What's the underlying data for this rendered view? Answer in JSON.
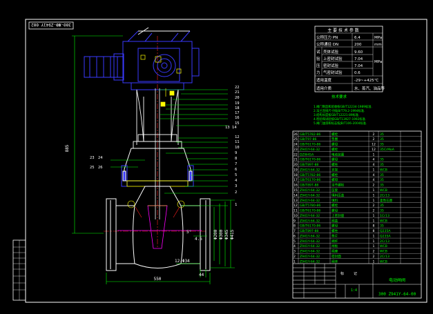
{
  "drawing_no_rotated": "300-ЖФ-Z941Y 002",
  "spec_table": {
    "title": "主 要 技 术 参 数",
    "rows": [
      {
        "label": "公称压力 PN",
        "value": "6.4",
        "unit": "MPa"
      },
      {
        "label": "公称通径 DN",
        "value": "200",
        "unit": "mm"
      },
      {
        "label": "壳体试验",
        "value": "9.60",
        "unit": ""
      },
      {
        "label": "上密封试验",
        "value": "7.04",
        "unit": "MPa"
      },
      {
        "label": "密封试验",
        "value": "7.04",
        "unit": ""
      },
      {
        "label": "气密封试验",
        "value": "0.6",
        "unit": ""
      },
      {
        "label": "适用温度",
        "value": "-29~+425",
        "unit": "℃"
      },
      {
        "label": "适用介质",
        "value": "水、蒸汽、油品等",
        "unit": ""
      }
    ],
    "side_chars": [
      "试",
      "验",
      "压",
      "力"
    ]
  },
  "notes": {
    "title": "技术要求",
    "lines": [
      "1.阀门制造和验收按GB/T12234-1989标准.",
      "2.法兰连接尺寸按JB/T79.2-1994标准.",
      "3.结构长度按GB/T12221-89标准.",
      "4.检验和试验按GB/T13927-1992标准.",
      "5.阀门油漆和标志按JB/T106-2004标准."
    ]
  },
  "dimensions": {
    "height": "885",
    "length": "550",
    "bolt": "12-Φ34",
    "d1": "Φ200",
    "d2": "Φ300",
    "d3": "Φ345",
    "d4": "Φ415",
    "t1": "44",
    "t2": "4.5",
    "angle": "5°"
  },
  "callouts_right": [
    "22",
    "21",
    "20",
    "19",
    "18",
    "17",
    "16",
    "15",
    "14",
    "13",
    "12",
    "11",
    "10",
    "9",
    "8",
    "7",
    "6",
    "5",
    "4",
    "3",
    "2",
    "1"
  ],
  "callouts_left": [
    "23",
    "24",
    "25",
    "26"
  ],
  "callout_pair_a": "13  14",
  "bom_rows": [
    {
      "no": "26",
      "code": "GB/T5782-86",
      "name": "螺栓",
      "qty": "2",
      "mat": "35"
    },
    {
      "no": "25",
      "code": "GB/T97-86",
      "name": "垫圈",
      "qty": "2",
      "mat": "35"
    },
    {
      "no": "24",
      "code": "GB/T6170-86",
      "name": "螺母",
      "qty": "12",
      "mat": "35"
    },
    {
      "no": "23",
      "code": "Z941Y-64-32",
      "name": "螺栓",
      "qty": "12",
      "mat": "35CrMoA"
    },
    {
      "no": "22",
      "code": "DZW45A",
      "name": "电动装置",
      "qty": "1",
      "mat": ""
    },
    {
      "no": "21",
      "code": "GB/T6170-86",
      "name": "螺母",
      "qty": "4",
      "mat": "35"
    },
    {
      "no": "20",
      "code": "GB/T897-88",
      "name": "螺柱",
      "qty": "4",
      "mat": "35"
    },
    {
      "no": "19",
      "code": "Z941Y-64-32",
      "name": "支架",
      "qty": "1",
      "mat": "WCB"
    },
    {
      "no": "18",
      "code": "GB/T5782-86",
      "name": "螺栓",
      "qty": "4",
      "mat": "35"
    },
    {
      "no": "17",
      "code": "GB/T6170-86",
      "name": "螺母",
      "qty": "4",
      "mat": "35"
    },
    {
      "no": "16",
      "code": "GB/T897-88",
      "name": "活节螺栓",
      "qty": "2",
      "mat": "35"
    },
    {
      "no": "15",
      "code": "Z941Y-64-32",
      "name": "压套",
      "qty": "1",
      "mat": "WCB"
    },
    {
      "no": "14",
      "code": "Z941Y-64-32",
      "name": "填料压盖",
      "qty": "1",
      "mat": "2Cr13"
    },
    {
      "no": "13",
      "code": "Z941Y-64-32",
      "name": "填料",
      "qty": "1",
      "mat": "柔性石墨"
    },
    {
      "no": "12",
      "code": "GB/T5780-86",
      "name": "螺栓",
      "qty": "2",
      "mat": "35"
    },
    {
      "no": "11",
      "code": "GB/T6170-86",
      "name": "螺母",
      "qty": "2",
      "mat": "35"
    },
    {
      "no": "10",
      "code": "Z941Y-64-32",
      "name": "上密封座",
      "qty": "1",
      "mat": "1Cr13"
    },
    {
      "no": "9",
      "code": "Z941Y-64-32",
      "name": "阀盖",
      "qty": "1",
      "mat": "WCB"
    },
    {
      "no": "8",
      "code": "GB/T6170-86",
      "name": "螺母",
      "qty": "8",
      "mat": "35"
    },
    {
      "no": "7",
      "code": "GB/T897-88",
      "name": "螺柱",
      "qty": "8",
      "mat": "Q235A"
    },
    {
      "no": "6",
      "code": "Z941Y-64-32",
      "name": "垫片",
      "qty": "1",
      "mat": "Q235A"
    },
    {
      "no": "5",
      "code": "Z941Y-64-32",
      "name": "阀杆",
      "qty": "1",
      "mat": "2Cr13"
    },
    {
      "no": "4",
      "code": "Z941Y-64-32",
      "name": "闸板",
      "qty": "1",
      "mat": "WCB"
    },
    {
      "no": "3",
      "code": "Z941Y-64-32",
      "name": "阀座",
      "qty": "2",
      "mat": "WCB"
    },
    {
      "no": "2",
      "code": "Z941Y-64-32",
      "name": "密封面",
      "qty": "2",
      "mat": "2Cr13"
    },
    {
      "no": "1",
      "code": "Z941Y-64-32",
      "name": "阀体",
      "qty": "1",
      "mat": "WCB"
    }
  ],
  "title_block": {
    "title": "电动闸阀",
    "drawing_no": "300 Z941Y-64-00",
    "scale_label": "1:4",
    "chars": [
      "标",
      "记"
    ]
  },
  "colors": {
    "background": "#000000",
    "frame": "#ffffff",
    "accent_green": "#00ff00",
    "blue": "#3a3aff",
    "magenta": "#ff00ff",
    "yellow": "#ffff00",
    "red": "#ff2020",
    "cyan": "#00ffff"
  }
}
